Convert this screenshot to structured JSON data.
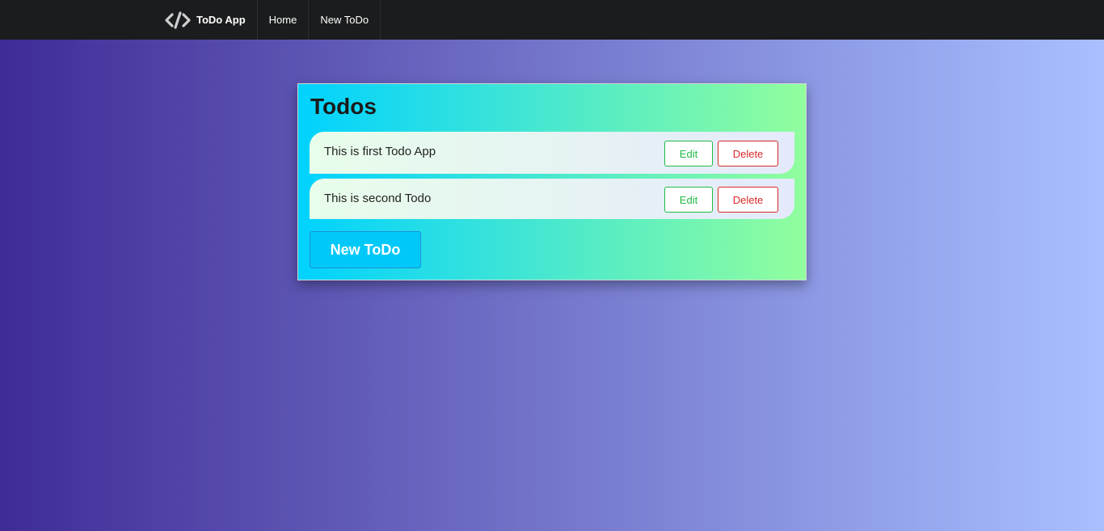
{
  "navbar": {
    "brand_label": "ToDo App",
    "brand_icon": "code-icon",
    "items": [
      {
        "label": "Home"
      },
      {
        "label": "New ToDo"
      }
    ]
  },
  "card": {
    "title": "Todos",
    "todos": [
      {
        "text": "This is first Todo App",
        "edit_label": "Edit",
        "delete_label": "Delete"
      },
      {
        "text": "This is second Todo",
        "edit_label": "Edit",
        "delete_label": "Delete"
      }
    ],
    "new_button_label": "New ToDo"
  },
  "colors": {
    "navbar_bg": "#1b1c1d",
    "page_gradient": [
      "#3f2b96",
      "#a8c0ff"
    ],
    "card_gradient": [
      "#00d2ff",
      "#92fe9d"
    ],
    "edit_accent": "#21ba45",
    "delete_accent": "#db2828"
  }
}
